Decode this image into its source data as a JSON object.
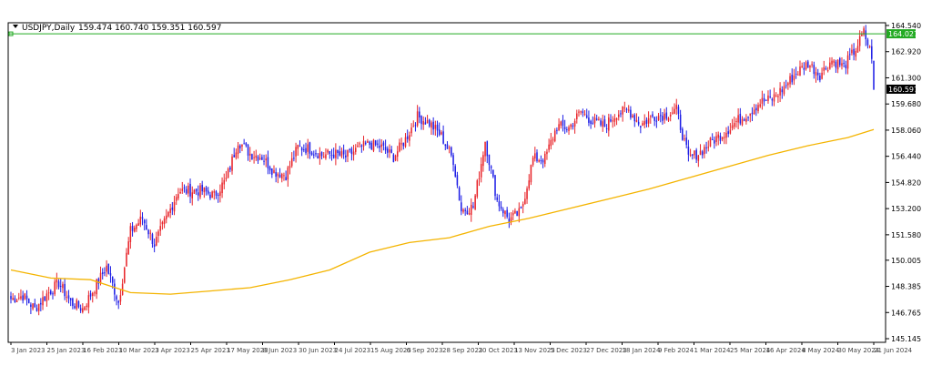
{
  "chart_data": {
    "type": "candlestick",
    "symbol_header": "USDJPY,Daily",
    "ohlc_header": "159.474 160.740 159.351 160.597",
    "y_ticks": [
      "164.540",
      "162.920",
      "161.300",
      "159.680",
      "158.060",
      "156.440",
      "154.820",
      "153.200",
      "151.580",
      "150.005",
      "148.385",
      "146.765",
      "145.145"
    ],
    "ylim": [
      145.145,
      164.54
    ],
    "price_marker_high": "164.027",
    "price_marker_current": "160.597",
    "x_labels": [
      "3 Jan 2023",
      "25 Jan 2023",
      "16 Feb 2023",
      "10 Mar 2023",
      "3 Apr 2023",
      "25 Apr 2023",
      "17 May 2023",
      "8 Jun 2023",
      "30 Jun 2023",
      "24 Jul 2023",
      "15 Aug 2023",
      "6 Sep 2023",
      "28 Sep 2023",
      "20 Oct 2023",
      "13 Nov 2023",
      "5 Dec 2023",
      "27 Dec 2023",
      "18 Jan 2024",
      "9 Feb 2024",
      "1 Mar 2024",
      "25 Mar 2024",
      "16 Apr 2024",
      "8 May 2024",
      "30 May 2024",
      "21 Jun 2024"
    ],
    "colors": {
      "up": "#e8242a",
      "down": "#1e1ee6",
      "ma": "#f4b400",
      "marker_line": "#22aa22",
      "current_bg": "#000000"
    },
    "anchors": [
      [
        0,
        147.6
      ],
      [
        6,
        147.8
      ],
      [
        12,
        147.0
      ],
      [
        18,
        147.9
      ],
      [
        24,
        148.6
      ],
      [
        30,
        147.4
      ],
      [
        36,
        147.0
      ],
      [
        42,
        148.3
      ],
      [
        48,
        149.6
      ],
      [
        54,
        147.4
      ],
      [
        60,
        151.8
      ],
      [
        66,
        152.6
      ],
      [
        72,
        151.0
      ],
      [
        78,
        152.6
      ],
      [
        84,
        154.3
      ],
      [
        90,
        154.3
      ],
      [
        96,
        154.3
      ],
      [
        102,
        154.0
      ],
      [
        108,
        155.0
      ],
      [
        114,
        157.4
      ],
      [
        120,
        156.6
      ],
      [
        126,
        156.4
      ],
      [
        132,
        155.5
      ],
      [
        138,
        155.3
      ],
      [
        144,
        157.0
      ],
      [
        150,
        156.9
      ],
      [
        156,
        156.5
      ],
      [
        162,
        156.6
      ],
      [
        168,
        156.4
      ],
      [
        174,
        156.9
      ],
      [
        180,
        157.2
      ],
      [
        186,
        157.0
      ],
      [
        192,
        156.4
      ],
      [
        198,
        157.5
      ],
      [
        204,
        158.9
      ],
      [
        210,
        158.5
      ],
      [
        216,
        157.7
      ],
      [
        222,
        156.2
      ],
      [
        226,
        153.1
      ],
      [
        232,
        153.3
      ],
      [
        238,
        157.4
      ],
      [
        244,
        153.7
      ],
      [
        250,
        152.5
      ],
      [
        256,
        153.0
      ],
      [
        262,
        156.3
      ],
      [
        268,
        156.3
      ],
      [
        274,
        158.3
      ],
      [
        280,
        158.2
      ],
      [
        286,
        159.2
      ],
      [
        292,
        158.6
      ],
      [
        298,
        158.3
      ],
      [
        304,
        159.1
      ],
      [
        310,
        159.3
      ],
      [
        316,
        158.4
      ],
      [
        322,
        158.9
      ],
      [
        328,
        159.0
      ],
      [
        334,
        159.3
      ],
      [
        340,
        156.3
      ],
      [
        346,
        156.7
      ],
      [
        352,
        157.4
      ],
      [
        358,
        157.9
      ],
      [
        364,
        158.6
      ],
      [
        370,
        159.1
      ],
      [
        376,
        159.8
      ],
      [
        382,
        160.0
      ],
      [
        388,
        160.7
      ],
      [
        394,
        161.6
      ],
      [
        400,
        162.2
      ],
      [
        406,
        161.5
      ],
      [
        412,
        162.4
      ],
      [
        418,
        162.0
      ],
      [
        424,
        163.1
      ],
      [
        428,
        164.1
      ],
      [
        432,
        162.7
      ],
      [
        433,
        160.6
      ]
    ],
    "ma_points": [
      [
        0,
        149.4
      ],
      [
        20,
        148.9
      ],
      [
        40,
        148.8
      ],
      [
        60,
        148.0
      ],
      [
        80,
        147.9
      ],
      [
        100,
        148.1
      ],
      [
        120,
        148.3
      ],
      [
        140,
        148.8
      ],
      [
        160,
        149.4
      ],
      [
        180,
        150.5
      ],
      [
        200,
        151.1
      ],
      [
        220,
        151.4
      ],
      [
        240,
        152.1
      ],
      [
        260,
        152.6
      ],
      [
        280,
        153.2
      ],
      [
        300,
        153.8
      ],
      [
        320,
        154.4
      ],
      [
        340,
        155.1
      ],
      [
        360,
        155.8
      ],
      [
        380,
        156.5
      ],
      [
        400,
        157.1
      ],
      [
        420,
        157.6
      ],
      [
        433,
        158.1
      ]
    ]
  }
}
